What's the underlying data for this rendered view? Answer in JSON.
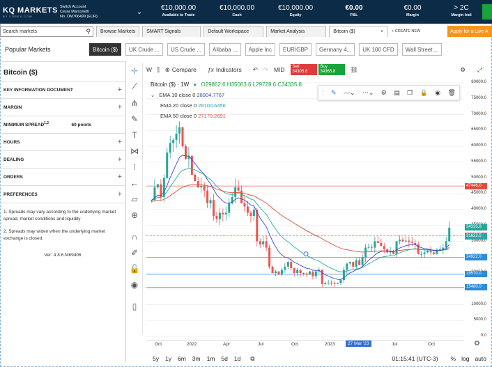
{
  "header": {
    "logo_main": "KQ MARKETS",
    "logo_sub": "BY FOREX.COM",
    "account_title": "Switch Account",
    "account_name": "Cesar Marconetti",
    "account_no": "No. DM766499 (EUR)",
    "stats": [
      {
        "value": "€10,000.00",
        "label": "Available to Trade"
      },
      {
        "value": "€10,000.00",
        "label": "Cash"
      },
      {
        "value": "€10,000.00",
        "label": "Equity"
      },
      {
        "value": "€0.00",
        "label": "P&L"
      },
      {
        "value": "€0.00",
        "label": "Margin"
      },
      {
        "value": "> 2C",
        "label": "Margin Indi"
      }
    ]
  },
  "tabs": {
    "search_placeholder": "Search markets",
    "items": [
      "Browse Markets",
      "SMART Signals",
      "Default Workspace",
      "Market Analysis",
      "Bitcoin ($)"
    ],
    "close": "×",
    "create_new": "+ CREATE NEW",
    "apply": "Apply for a Live A"
  },
  "popular": {
    "label": "Popular Markets",
    "items": [
      "Bitcoin ($)",
      "UK Crude ...",
      "US Crude ...",
      "Alibaba ...",
      "Apple Inc",
      "EUR/GBP",
      "Germany 4...",
      "UK 100 CFD",
      "Wall Street ..."
    ]
  },
  "left_panel": {
    "title": "Bitcoin ($)",
    "sections": [
      "KEY INFORMATION DOCUMENT",
      "MARGIN"
    ],
    "spread_label": "MINIMUM SPREAD",
    "spread_sup": "1,2",
    "spread_value": "60 points",
    "sections2": [
      "HOURS",
      "DEALING",
      "ORDERS",
      "PREFERENCES"
    ],
    "plus": "+",
    "notes": [
      "1. Spreads may vary according to the underlying market spread, market conditions and liquidity",
      "2. Spreads may widen when the underlying market exchange is closed."
    ],
    "version": "Ver: 4.8.6.f469406"
  },
  "chart_toolbar": {
    "interval": "W",
    "compare": "Compare",
    "indicators": "Indicators",
    "mid": "MID",
    "sell_label": "Sell",
    "sell_price": "34305.8",
    "buy_label": "Buy",
    "buy_price": "34365.8"
  },
  "legend": {
    "symbol": "Bitcoin ($) · 1W",
    "ohlc": "O29862.6  H35003.6  L29728.6  C34335.8",
    "ema": [
      {
        "label": "EMA 10 close 0",
        "value": "28904.7767",
        "color": "#3a46c9"
      },
      {
        "label": "EMA 20 close 0",
        "value": "28100.6456",
        "color": "#2aa6a6"
      },
      {
        "label": "EMA 50 close 0",
        "value": "27170.2691",
        "color": "#e04c3c"
      }
    ]
  },
  "bottom": {
    "timeframes": [
      "5y",
      "1y",
      "6m",
      "3m",
      "1m",
      "5d",
      "1d"
    ],
    "clock": "01:15:41 (UTC-3)",
    "pct": "%",
    "log": "log",
    "auto": "auto"
  },
  "colors": {
    "up": "#26a69a",
    "down": "#ef5350",
    "topbar": "#0b2b47",
    "accent": "#f7941d"
  },
  "chart_data": {
    "type": "candlestick",
    "title": "Bitcoin ($) · 1W",
    "ylim": [
      0,
      80000
    ],
    "yticks": [
      80000,
      75000,
      70000,
      65000,
      60000,
      55000,
      50000,
      45000,
      40000,
      35000,
      30000,
      25000,
      20000,
      15000,
      10000,
      5000,
      0
    ],
    "xticks": [
      "Oct",
      "2022",
      "Apr",
      "Jul",
      "Oct",
      "2023",
      "Apr",
      "Jul",
      "Oct"
    ],
    "x_highlight": "27 Mar '23",
    "price_labels": [
      {
        "value": "47446.0",
        "color": "#e04c3c"
      },
      {
        "value": "34335.8",
        "color": "#26a69a"
      },
      {
        "value": "31825.0",
        "color": "#ef5350"
      },
      {
        "value": "31622.5",
        "color": "#2aa6a6"
      },
      {
        "value": "24922.0",
        "color": "#2e8bd8"
      },
      {
        "value": "19570.0",
        "color": "#2e8bd8"
      },
      {
        "value": "15480.0",
        "color": "#2e8bd8"
      }
    ],
    "series_close": [
      43000,
      47000,
      48000,
      44000,
      50000,
      58000,
      61000,
      62000,
      64000,
      66000,
      60000,
      56000,
      57000,
      51000,
      49000,
      47000,
      47500,
      46000,
      42000,
      43000,
      38000,
      37000,
      39000,
      38500,
      39000,
      42000,
      44000,
      47000,
      46000,
      42000,
      41000,
      39000,
      38000,
      40000,
      30000,
      29000,
      30000,
      28000,
      22000,
      20000,
      20500,
      19500,
      21000,
      22000,
      23500,
      21500,
      20000,
      21000,
      20000,
      19800,
      19500,
      20500,
      19000,
      20500,
      21000,
      16500,
      16800,
      17000,
      16700,
      16600,
      16800,
      17800,
      21000,
      23000,
      23500,
      22000,
      24000,
      22500,
      25000,
      28000,
      28200,
      28000,
      30000,
      29500,
      28500,
      27500,
      26500,
      27000,
      26000,
      30000,
      30500,
      30000,
      30200,
      29800,
      29500,
      29000,
      26000,
      26000,
      26500,
      27000,
      26500,
      26000,
      27000,
      27500,
      28000,
      30000,
      34335
    ]
  }
}
